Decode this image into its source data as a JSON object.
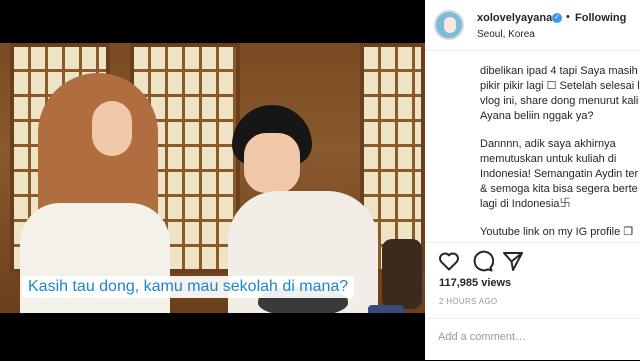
{
  "video": {
    "subtitle": "Kasih tau dong, kamu mau sekolah di mana?"
  },
  "post": {
    "username": "xolovelyayana",
    "follow_label": "Following",
    "location": "Seoul, Korea",
    "caption_lines": [
      [
        "dibelikan ipad 4 tapi Saya masih",
        "pikir pikir lagi ☐ Setelah selesai li",
        "vlog ini, share dong menurut kali",
        "Ayana beliin nggak ya?"
      ],
      [
        "Dannnn, adik saya akhirnya",
        "memutuskan untuk kuliah di",
        "Indonesia! Semangatin Aydin ter",
        "& semoga kita bisa segera berte",
        "lagi di Indonesia࿕"
      ],
      [
        "Youtube link on my IG profile ❐"
      ]
    ],
    "views": "117,985 views",
    "time": "2 HOURS AGO",
    "comment_placeholder": "Add a comment…"
  },
  "icons": {
    "like": "heart-icon",
    "comment": "comment-icon",
    "share": "share-icon",
    "verified": "verified-badge-icon"
  },
  "colors": {
    "subtitle_text": "#1d87c8",
    "verified": "#3897f0",
    "meta_gray": "#999999"
  }
}
